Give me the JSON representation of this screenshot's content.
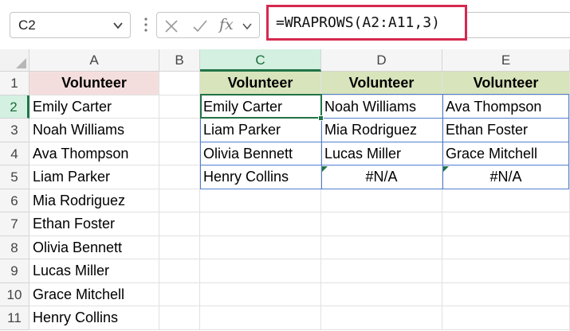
{
  "formula_bar": {
    "name_box": "C2",
    "formula": "=WRAPROWS(A2:A11,3)",
    "fx_label": "fx"
  },
  "columns": [
    "A",
    "B",
    "C",
    "D",
    "E"
  ],
  "rows": [
    "1",
    "2",
    "3",
    "4",
    "5",
    "6",
    "7",
    "8",
    "9",
    "10",
    "11"
  ],
  "source": {
    "header": "Volunteer",
    "values": [
      "Emily Carter",
      "Noah Williams",
      "Ava Thompson",
      "Liam Parker",
      "Mia Rodriguez",
      "Ethan Foster",
      "Olivia Bennett",
      "Lucas Miller",
      "Grace Mitchell",
      "Henry Collins"
    ]
  },
  "output": {
    "headers": [
      "Volunteer",
      "Volunteer",
      "Volunteer"
    ],
    "rows": [
      [
        "Emily Carter",
        "Noah Williams",
        "Ava Thompson"
      ],
      [
        "Liam Parker",
        "Mia Rodriguez",
        "Ethan Foster"
      ],
      [
        "Olivia Bennett",
        "Lucas Miller",
        "Grace Mitchell"
      ],
      [
        "Henry Collins",
        "#N/A",
        "#N/A"
      ]
    ]
  },
  "colors": {
    "formula_highlight": "#d6294f",
    "source_header_fill": "#f4dedd",
    "output_header_fill": "#d8e4bc",
    "spill_border": "#4f7fd0",
    "selection_green": "#217346"
  }
}
